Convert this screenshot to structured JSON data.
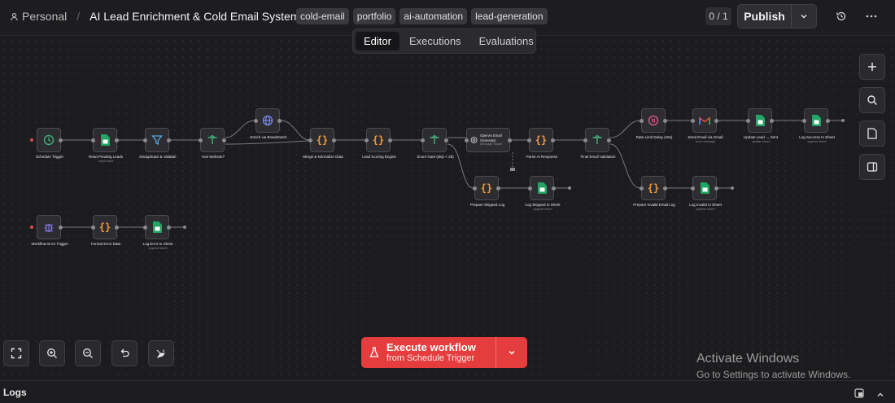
{
  "header": {
    "workspace": "Personal",
    "title": "AI Lead Enrichment & Cold Email System",
    "tags": [
      "cold-email",
      "portfolio",
      "ai-automation",
      "lead-generation"
    ],
    "counter": "0 / 1",
    "publish_label": "Publish"
  },
  "tabs": [
    {
      "label": "Editor",
      "active": true
    },
    {
      "label": "Executions",
      "active": false
    },
    {
      "label": "Evaluations",
      "active": false
    }
  ],
  "nodes": {
    "schedule_trigger": {
      "label": "Schedule Trigger",
      "sub": "",
      "icon": "clock-icon"
    },
    "read_pending": {
      "label": "Read Pending Leads",
      "sub": "read sheet",
      "icon": "sheets-icon"
    },
    "dedupe": {
      "label": "Deduplicate & Validate",
      "sub": "",
      "icon": "filter-icon"
    },
    "has_website": {
      "label": "Has Website?",
      "sub": "",
      "icon": "branch-icon"
    },
    "enrich": {
      "label": "Enrich via BrandGetch",
      "sub": "",
      "icon": "globe-icon"
    },
    "merge": {
      "label": "Merge & Normalize Data",
      "sub": "",
      "icon": "code-icon"
    },
    "scoring": {
      "label": "Lead Scoring Engine",
      "sub": "",
      "icon": "code-icon"
    },
    "score_gate": {
      "label": "Score Gate (skip < 25)",
      "sub": "",
      "icon": "branch-icon"
    },
    "openai": {
      "label": "OpenAI Email Generator",
      "sub": "Message Model",
      "icon": "openai-icon"
    },
    "parse_ai": {
      "label": "Parse AI Response",
      "sub": "",
      "icon": "code-icon"
    },
    "final_validation": {
      "label": "Final Email Validation",
      "sub": "",
      "icon": "branch-icon"
    },
    "rate_limit": {
      "label": "Rate-Limit Delay (45s)",
      "sub": "",
      "icon": "pause-icon"
    },
    "send_gmail": {
      "label": "Send Email via Gmail",
      "sub": "send message",
      "icon": "gmail-icon"
    },
    "update_lead": {
      "label": "Update Lead → Sent",
      "sub": "update sheet",
      "icon": "sheets-icon"
    },
    "log_success": {
      "label": "Log Success to Sheet",
      "sub": "append sheet",
      "icon": "sheets-icon"
    },
    "prep_skipped": {
      "label": "Prepare Skipped Log",
      "sub": "",
      "icon": "code-icon"
    },
    "log_skipped": {
      "label": "Log Skipped to Sheet",
      "sub": "append sheet",
      "icon": "sheets-icon"
    },
    "prep_invalid": {
      "label": "Prepare Invalid Email Log",
      "sub": "",
      "icon": "code-icon"
    },
    "log_invalid": {
      "label": "Log Invalid to Sheet",
      "sub": "append sheet",
      "icon": "sheets-icon"
    },
    "error_trigger": {
      "label": "Workflow Error Trigger",
      "sub": "",
      "icon": "bug-icon"
    },
    "format_error": {
      "label": "Format Error Data",
      "sub": "",
      "icon": "code-icon"
    },
    "log_error": {
      "label": "Log Error to Sheet",
      "sub": "append sheet",
      "icon": "sheets-icon"
    }
  },
  "execute": {
    "line1": "Execute workflow",
    "line2": "from Schedule Trigger"
  },
  "watermark": {
    "line1": "Activate Windows",
    "line2": "Go to Settings to activate Windows."
  },
  "logs": {
    "label": "Logs"
  },
  "colors": {
    "accent": "#e53d3d",
    "sheets": "#21a464",
    "code": "#f29b38",
    "branch": "#43b07a",
    "filter": "#5aa7e0",
    "globe": "#7f8cf0"
  }
}
